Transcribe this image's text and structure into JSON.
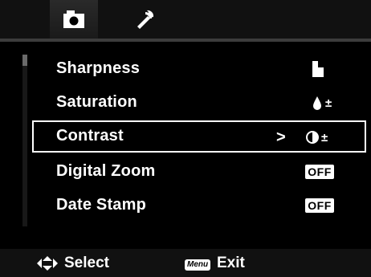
{
  "tabs": [
    {
      "icon": "camera-icon",
      "active": true
    },
    {
      "icon": "wrench-icon",
      "active": false
    }
  ],
  "menu": {
    "items": [
      {
        "label": "Sharpness",
        "value_icon": "sharpness-icon",
        "selected": false
      },
      {
        "label": "Saturation",
        "value_icon": "saturation-icon",
        "selected": false
      },
      {
        "label": "Contrast",
        "value_icon": "contrast-icon",
        "selected": true
      },
      {
        "label": "Digital Zoom",
        "value_text": "OFF",
        "selected": false
      },
      {
        "label": "Date Stamp",
        "value_text": "OFF",
        "selected": false
      }
    ],
    "selected_arrow": ">"
  },
  "footer": {
    "nav_label": "Select",
    "menu_key": "Menu",
    "exit_label": "Exit"
  },
  "colors": {
    "background": "#000000",
    "text": "#ffffff",
    "selection_border": "#ffffff"
  }
}
